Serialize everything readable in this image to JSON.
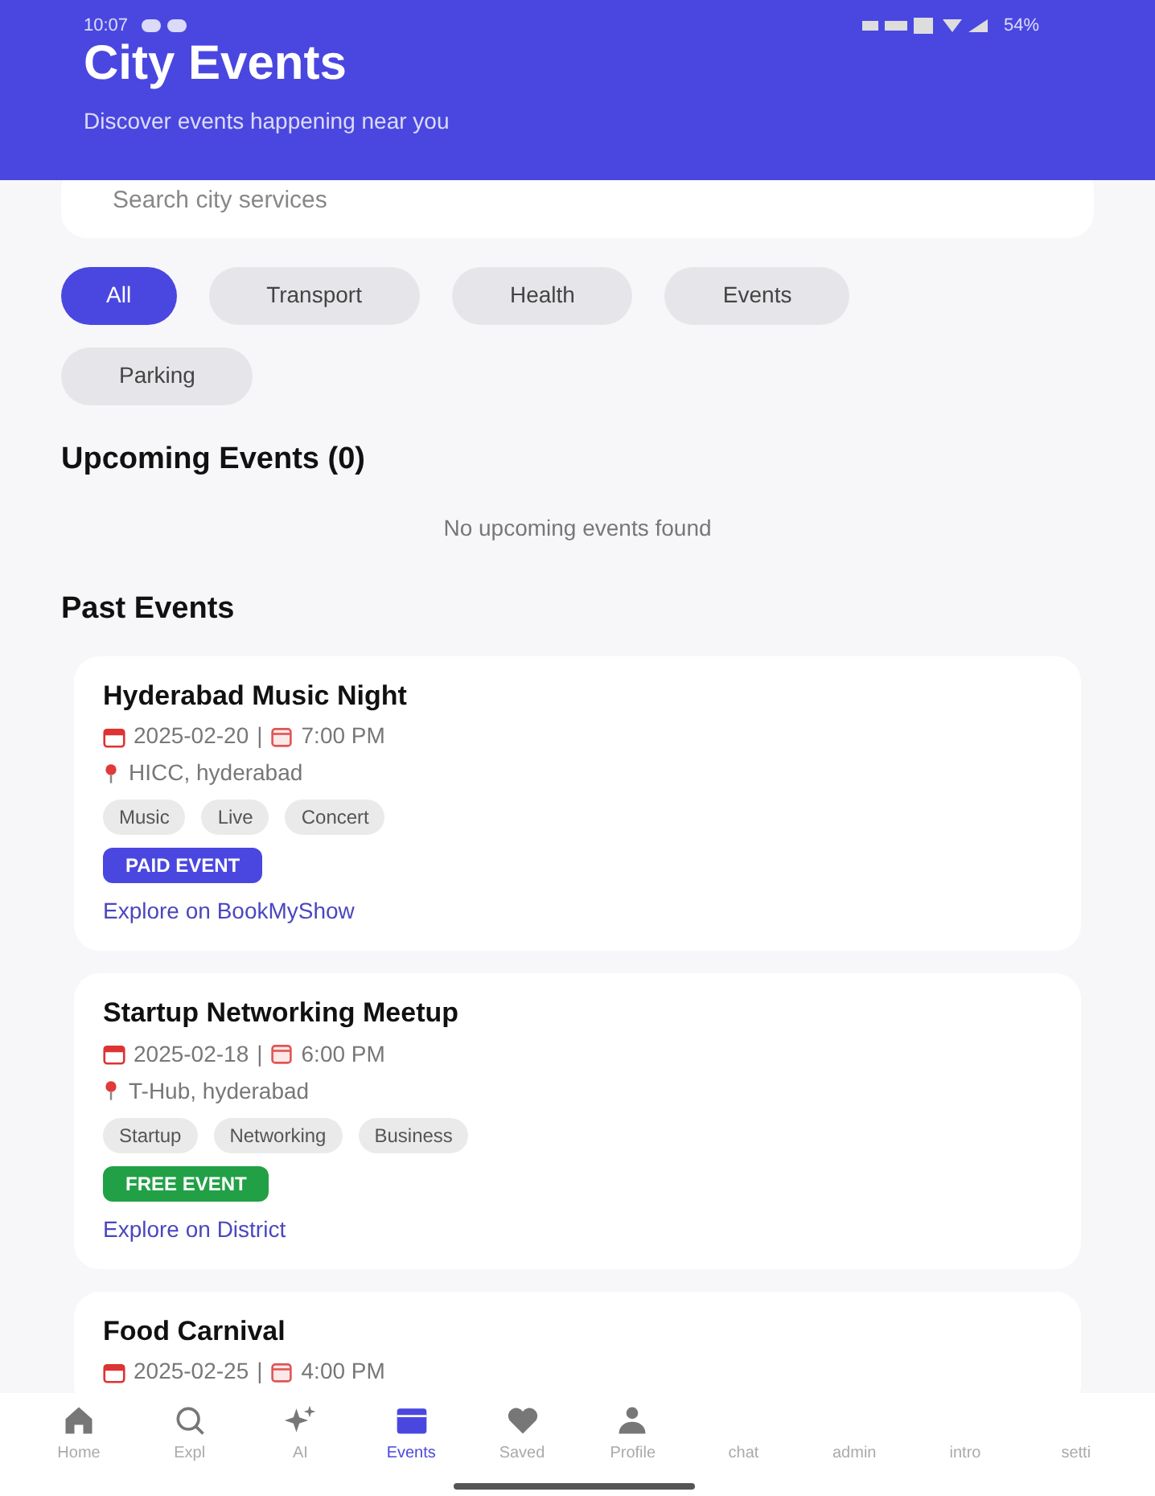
{
  "status_bar": {
    "time": "10:07",
    "battery": "54%"
  },
  "header": {
    "title": "City Events",
    "subtitle": "Discover events happening near you"
  },
  "search": {
    "placeholder": "Search city services"
  },
  "filters": [
    {
      "label": "All",
      "selected": true
    },
    {
      "label": "Transport",
      "selected": false
    },
    {
      "label": "Health",
      "selected": false
    },
    {
      "label": "Events",
      "selected": false
    },
    {
      "label": "Parking",
      "selected": false
    }
  ],
  "upcoming": {
    "heading": "Upcoming Events (0)",
    "empty_text": "No upcoming events found"
  },
  "past": {
    "heading": "Past Events",
    "events": [
      {
        "title": "Hyderabad Music Night",
        "date": "2025-02-20",
        "separator": "|",
        "time": "7:00 PM",
        "location": "HICC, hyderabad",
        "tags": [
          "Music",
          "Live",
          "Concert"
        ],
        "price": {
          "kind": "paid",
          "label": "PAID EVENT"
        },
        "link": "Explore on BookMyShow"
      },
      {
        "title": "Startup Networking Meetup",
        "date": "2025-02-18",
        "separator": "|",
        "time": "6:00 PM",
        "location": "T-Hub, hyderabad",
        "tags": [
          "Startup",
          "Networking",
          "Business"
        ],
        "price": {
          "kind": "free",
          "label": "FREE EVENT"
        },
        "link": "Explore on District"
      },
      {
        "title": "Food Carnival",
        "date": "2025-02-25",
        "separator": "|",
        "time": "4:00 PM"
      }
    ]
  },
  "nav": [
    {
      "label": "Home",
      "selected": false
    },
    {
      "label": "Expl",
      "selected": false
    },
    {
      "label": "AI",
      "selected": false
    },
    {
      "label": "Events",
      "selected": true
    },
    {
      "label": "Saved",
      "selected": false
    },
    {
      "label": "Profile",
      "selected": false
    },
    {
      "label": "chat",
      "selected": false
    },
    {
      "label": "admin",
      "selected": false
    },
    {
      "label": "intro",
      "selected": false
    },
    {
      "label": "setti",
      "selected": false
    }
  ]
}
